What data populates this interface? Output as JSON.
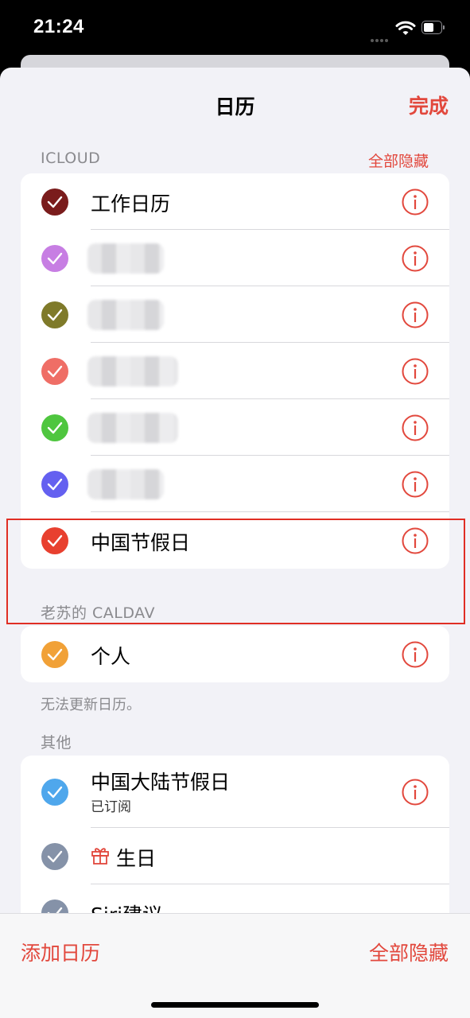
{
  "status_bar": {
    "time": "21:24"
  },
  "nav": {
    "title": "日历",
    "done": "完成"
  },
  "sections": {
    "icloud": {
      "header": "ICLOUD",
      "action": "全部隐藏",
      "items": [
        {
          "label": "工作日历",
          "color": "#7a1c1c"
        },
        {
          "label": "",
          "color": "#c77ee3",
          "redacted": true
        },
        {
          "label": "",
          "color": "#7f7a2a",
          "redacted": true
        },
        {
          "label": "",
          "color": "#ef6e66",
          "redacted": true
        },
        {
          "label": "",
          "color": "#4fc63f",
          "redacted": true
        },
        {
          "label": "",
          "color": "#6460f0",
          "redacted": true
        },
        {
          "label": "中国节假日",
          "color": "#e8402f"
        }
      ]
    },
    "caldav": {
      "header": "老苏的 CALDAV",
      "items": [
        {
          "label": "个人",
          "color": "#f1a137"
        }
      ],
      "footer": "无法更新日历。"
    },
    "other": {
      "header": "其他",
      "items": [
        {
          "label": "中国大陆节假日",
          "sublabel": "已订阅",
          "color": "#4fa7ec"
        },
        {
          "label": "生日",
          "color": "#8592a8",
          "icon": "gift-icon"
        },
        {
          "label": "Siri建议",
          "color": "#8592a8"
        }
      ]
    }
  },
  "toolbar": {
    "add": "添加日历",
    "hide_all": "全部隐藏"
  },
  "colors": {
    "accent": "#e2483d",
    "background": "#f2f2f7"
  }
}
